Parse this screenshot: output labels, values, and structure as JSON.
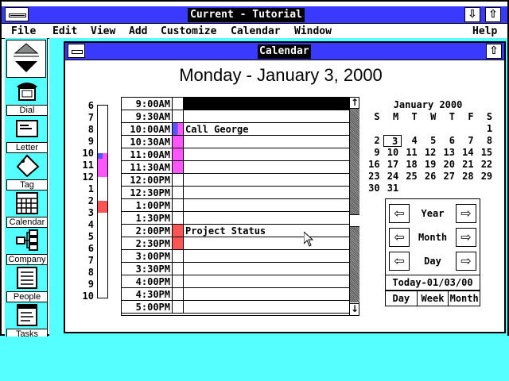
{
  "app": {
    "title": "Current - Tutorial",
    "minimize_icon": "down-arrow-icon",
    "maximize_icon": "up-arrow-icon"
  },
  "menu": [
    "File",
    "Edit",
    "View",
    "Add",
    "Customize",
    "Calendar",
    "Window",
    "Help"
  ],
  "sidebar": {
    "tools": [
      {
        "label": "Dial",
        "icon": "telephone-icon"
      },
      {
        "label": "Letter",
        "icon": "envelope-icon"
      },
      {
        "label": "Tag",
        "icon": "tag-icon"
      },
      {
        "label": "Calendar",
        "icon": "calendar-icon"
      },
      {
        "label": "Company",
        "icon": "org-chart-icon"
      },
      {
        "label": "People",
        "icon": "people-list-icon"
      },
      {
        "label": "Tasks",
        "icon": "tasks-icon"
      }
    ]
  },
  "calendar_window": {
    "title": "Calendar",
    "heading": "Monday - January 3, 2000",
    "hour_labels": [
      "6",
      "7",
      "8",
      "9",
      "10",
      "11",
      "12",
      "1",
      "2",
      "3",
      "4",
      "5",
      "6",
      "7",
      "8",
      "9",
      "10"
    ],
    "time_slots": [
      {
        "time": "9:00AM",
        "text": "",
        "mark": "none"
      },
      {
        "time": "9:30AM",
        "text": "",
        "mark": "none"
      },
      {
        "time": "10:00AM",
        "text": "Call George",
        "mark": "blue-magenta"
      },
      {
        "time": "10:30AM",
        "text": "",
        "mark": "magenta"
      },
      {
        "time": "11:00AM",
        "text": "",
        "mark": "magenta"
      },
      {
        "time": "11:30AM",
        "text": "",
        "mark": "magenta"
      },
      {
        "time": "12:00PM",
        "text": "",
        "mark": "none"
      },
      {
        "time": "12:30PM",
        "text": "",
        "mark": "none"
      },
      {
        "time": "1:00PM",
        "text": "",
        "mark": "none"
      },
      {
        "time": "1:30PM",
        "text": "",
        "mark": "none"
      },
      {
        "time": "2:00PM",
        "text": "Project Status",
        "mark": "red"
      },
      {
        "time": "2:30PM",
        "text": "",
        "mark": "red"
      },
      {
        "time": "3:00PM",
        "text": "",
        "mark": "none"
      },
      {
        "time": "3:30PM",
        "text": "",
        "mark": "none"
      },
      {
        "time": "4:00PM",
        "text": "",
        "mark": "none"
      },
      {
        "time": "4:30PM",
        "text": "",
        "mark": "none"
      },
      {
        "time": "5:00PM",
        "text": "",
        "mark": "none"
      }
    ],
    "mini_calendar": {
      "title": "January 2000",
      "weekdays": [
        "S",
        "M",
        "T",
        "W",
        "T",
        "F",
        "S"
      ],
      "leading_blanks": 6,
      "days": 31,
      "selected": 3
    },
    "nav": {
      "year": "Year",
      "month": "Month",
      "day": "Day"
    },
    "today": "Today-01/03/00",
    "views": [
      "Day",
      "Week",
      "Month"
    ]
  },
  "colors": {
    "titlebar": "#3a3aff",
    "desktop": "#55ffff",
    "magenta": "#ff55ff",
    "red": "#ff5555",
    "blue": "#5555ff"
  }
}
